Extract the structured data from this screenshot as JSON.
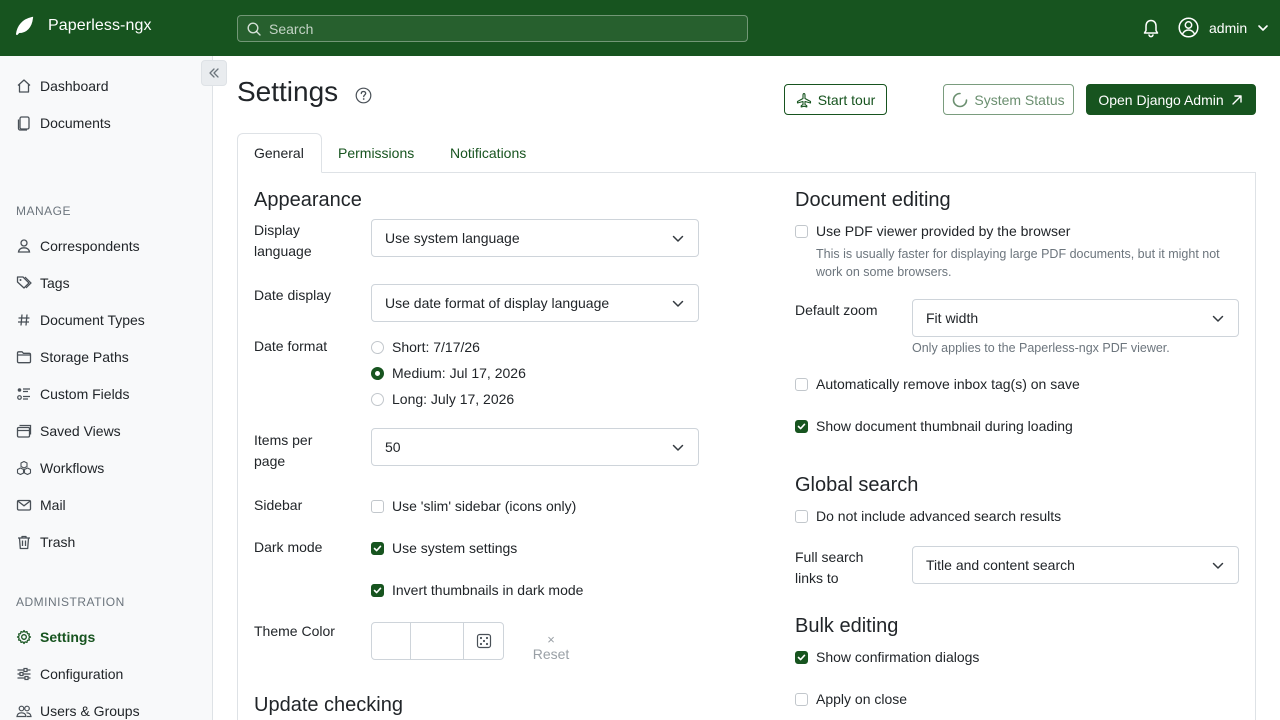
{
  "header": {
    "app_name": "Paperless-ngx",
    "search_placeholder": "Search",
    "user_name": "admin"
  },
  "sidebar": {
    "main_items": [
      {
        "label": "Dashboard",
        "icon": "house-icon"
      },
      {
        "label": "Documents",
        "icon": "files-icon"
      }
    ],
    "manage_label": "MANAGE",
    "manage_items": [
      {
        "label": "Correspondents",
        "icon": "person-icon"
      },
      {
        "label": "Tags",
        "icon": "tags-icon"
      },
      {
        "label": "Document Types",
        "icon": "hash-icon"
      },
      {
        "label": "Storage Paths",
        "icon": "folder-icon"
      },
      {
        "label": "Custom Fields",
        "icon": "ui-radios-icon"
      },
      {
        "label": "Saved Views",
        "icon": "window-stack-icon"
      },
      {
        "label": "Workflows",
        "icon": "boxes-icon"
      },
      {
        "label": "Mail",
        "icon": "envelope-icon"
      },
      {
        "label": "Trash",
        "icon": "trash-icon"
      }
    ],
    "admin_label": "ADMINISTRATION",
    "admin_items": [
      {
        "label": "Settings",
        "icon": "gear-icon",
        "active": true
      },
      {
        "label": "Configuration",
        "icon": "sliders-icon"
      },
      {
        "label": "Users & Groups",
        "icon": "people-icon"
      }
    ]
  },
  "page": {
    "title": "Settings",
    "start_tour": "Start tour",
    "system_status": "System Status",
    "open_django_admin": "Open Django Admin"
  },
  "tabs": [
    {
      "label": "General",
      "active": true
    },
    {
      "label": "Permissions"
    },
    {
      "label": "Notifications"
    }
  ],
  "appearance": {
    "heading": "Appearance",
    "display_language_label": "Display language",
    "display_language_value": "Use system language",
    "date_display_label": "Date display",
    "date_display_value": "Use date format of display language",
    "date_format_label": "Date format",
    "date_format_options": [
      {
        "label": "Short: 7/17/26",
        "selected": false
      },
      {
        "label": "Medium: Jul 17, 2026",
        "selected": true
      },
      {
        "label": "Long: July 17, 2026",
        "selected": false
      }
    ],
    "items_per_page_label": "Items per page",
    "items_per_page_value": "50",
    "sidebar_label": "Sidebar",
    "slim_sidebar": "Use 'slim' sidebar (icons only)",
    "dark_mode_label": "Dark mode",
    "use_system_settings": "Use system settings",
    "invert_thumbnails": "Invert thumbnails in dark mode",
    "theme_color_label": "Theme Color",
    "reset_label": "Reset"
  },
  "update_checking": {
    "heading": "Update checking"
  },
  "document_editing": {
    "heading": "Document editing",
    "use_pdf_viewer": "Use PDF viewer provided by the browser",
    "pdf_hint": "This is usually faster for displaying large PDF documents, but it might not work on some browsers.",
    "default_zoom_label": "Default zoom",
    "default_zoom_value": "Fit width",
    "zoom_hint": "Only applies to the Paperless-ngx PDF viewer.",
    "auto_remove_inbox": "Automatically remove inbox tag(s) on save",
    "show_thumbnail": "Show document thumbnail during loading"
  },
  "global_search": {
    "heading": "Global search",
    "no_advanced": "Do not include advanced search results",
    "full_search_label": "Full search links to",
    "full_search_value": "Title and content search"
  },
  "bulk_editing": {
    "heading": "Bulk editing",
    "show_confirmation": "Show confirmation dialogs",
    "apply_on_close": "Apply on close"
  },
  "colors": {
    "primary": "#17541f",
    "border": "#dee2e6"
  }
}
